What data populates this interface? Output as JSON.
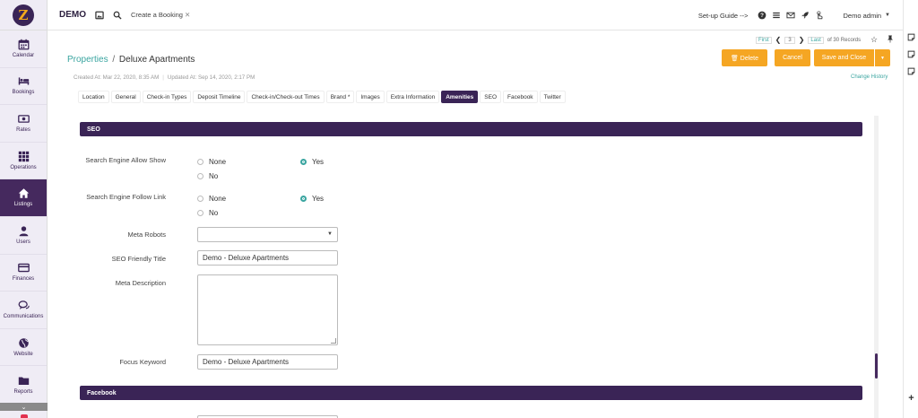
{
  "sidebar": {
    "logo_letter": "Z",
    "items": [
      {
        "label": "Calendar",
        "icon": "calendar-icon"
      },
      {
        "label": "Bookings",
        "icon": "bed-icon"
      },
      {
        "label": "Rates",
        "icon": "money-icon"
      },
      {
        "label": "Operations",
        "icon": "grid-icon"
      },
      {
        "label": "Listings",
        "icon": "home-icon",
        "active": true
      },
      {
        "label": "Users",
        "icon": "user-icon"
      },
      {
        "label": "Finances",
        "icon": "credit-card-icon"
      },
      {
        "label": "Communications",
        "icon": "chat-icon"
      },
      {
        "label": "Website",
        "icon": "globe-icon"
      },
      {
        "label": "Reports",
        "icon": "folder-icon"
      }
    ],
    "scroll_down_glyph": "⌄"
  },
  "topbar": {
    "brand": "DEMO",
    "crumb": "Create a Booking",
    "crumb_close": "✕",
    "setup_guide": "Set-up Guide -->",
    "user": "Demo admin",
    "user_caret": "▼"
  },
  "record_nav": {
    "first": "First",
    "prev": "❮",
    "current": "3",
    "next": "❯",
    "last": "Last",
    "of_records": "of 30 Records"
  },
  "actions": {
    "delete": "🗑 Delete",
    "cancel": "Cancel",
    "save_and_close": "Save and Close",
    "save_caret": "▼",
    "star": "☆"
  },
  "breadcrumb": {
    "parent": "Properties",
    "separator": "/",
    "current": "Deluxe Apartments"
  },
  "meta": {
    "created": "Created At: Mar 22, 2020, 8:35 AM",
    "divider": "|",
    "updated": "Updated At: Sep 14, 2020, 2:17 PM"
  },
  "change_history": "Change History",
  "tabs": [
    {
      "label": "Location"
    },
    {
      "label": "General"
    },
    {
      "label": "Check-in Types"
    },
    {
      "label": "Deposit Timeline"
    },
    {
      "label": "Check-in/Check-out Times"
    },
    {
      "label": "Brand *"
    },
    {
      "label": "Images"
    },
    {
      "label": "Extra Information"
    },
    {
      "label": "Amenities",
      "active": true
    },
    {
      "label": "SEO"
    },
    {
      "label": "Facebook"
    },
    {
      "label": "Twitter"
    }
  ],
  "seo_section": {
    "title": "SEO",
    "allow_show": {
      "label": "Search Engine Allow Show",
      "options": [
        "None",
        "Yes",
        "No"
      ],
      "selected": "Yes"
    },
    "follow_link": {
      "label": "Search Engine Follow Link",
      "options": [
        "None",
        "Yes",
        "No"
      ],
      "selected": "Yes"
    },
    "meta_robots": {
      "label": "Meta Robots",
      "value": "",
      "caret": "▼"
    },
    "friendly_title": {
      "label": "SEO Friendly Title",
      "value": "Demo - Deluxe Apartments"
    },
    "meta_description": {
      "label": "Meta Description",
      "value": ""
    },
    "focus_keyword": {
      "label": "Focus Keyword",
      "value": "Demo - Deluxe Apartments"
    }
  },
  "facebook_section": {
    "title": "Facebook"
  },
  "right_rail": {
    "plus": "+"
  },
  "colors": {
    "primary": "#3a2456",
    "accent": "#f5a623",
    "link": "#3aa5a0"
  }
}
